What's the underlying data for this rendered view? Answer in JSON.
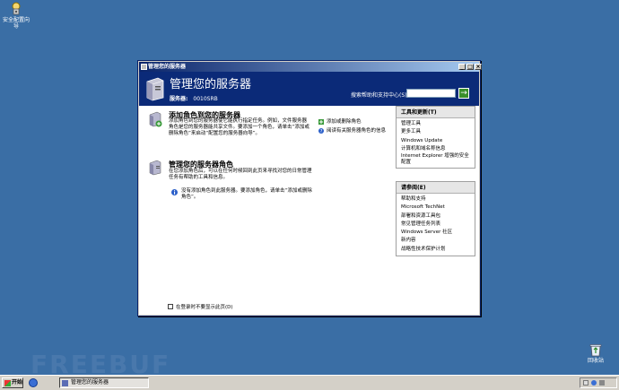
{
  "desktop": {
    "security_icon_label": "安全配置向导",
    "recycle_icon_label": "回收站"
  },
  "watermark": "FREEBUF",
  "window": {
    "title": "管理您的服务器",
    "controls": {
      "minimize": "_",
      "maximize": "□",
      "close": "×"
    },
    "header": {
      "title": "管理您的服务器",
      "server_label": "服务器:",
      "server_name": "0010SRB",
      "search_label": "搜索帮助和支持中心(S)",
      "search_placeholder": "",
      "go_label": "→"
    },
    "section_add": {
      "title": "添加角色到您的服务器",
      "desc": "添加角色到您的服务器使它能执行指定任务。例如，文件服务器 角色是您的服务器能共享文件。要添加一个角色，请单击“添加或删除角色”来启动“配置您的服务器向导”。",
      "links": [
        {
          "label": "添加或删除角色",
          "icon": "green-plus-icon"
        },
        {
          "label": "阅读有关服务器角色的信息",
          "icon": "help-icon"
        }
      ]
    },
    "section_manage": {
      "title": "管理您的服务器角色",
      "desc": "在您添加角色后，可以在任何时候回到此页来寻找对您的日常管理任务有帮助的工具和信息。",
      "info": "没有添加角色到此服务器。要添加角色，请单击“添加或删除角色”。"
    },
    "panel_tools": {
      "title": "工具和更新(T)",
      "items": [
        "管理工具",
        "更多工具",
        "Windows Update",
        "计算机和域名称信息",
        "Internet Explorer 增强的安全配置"
      ]
    },
    "panel_more": {
      "title": "请参阅(E)",
      "items": [
        "帮助和支持",
        "Microsoft TechNet",
        "部署和资源工具包",
        "常见管理任务列表",
        "Windows Server 社区",
        "新内容",
        "战略性技术保护计划"
      ]
    },
    "checkbox_label": "在登录时不要显示此页(D)",
    "checkbox_checked": false
  },
  "taskbar": {
    "start_label": "开始",
    "task_label": "管理您的服务器",
    "clock": ""
  }
}
